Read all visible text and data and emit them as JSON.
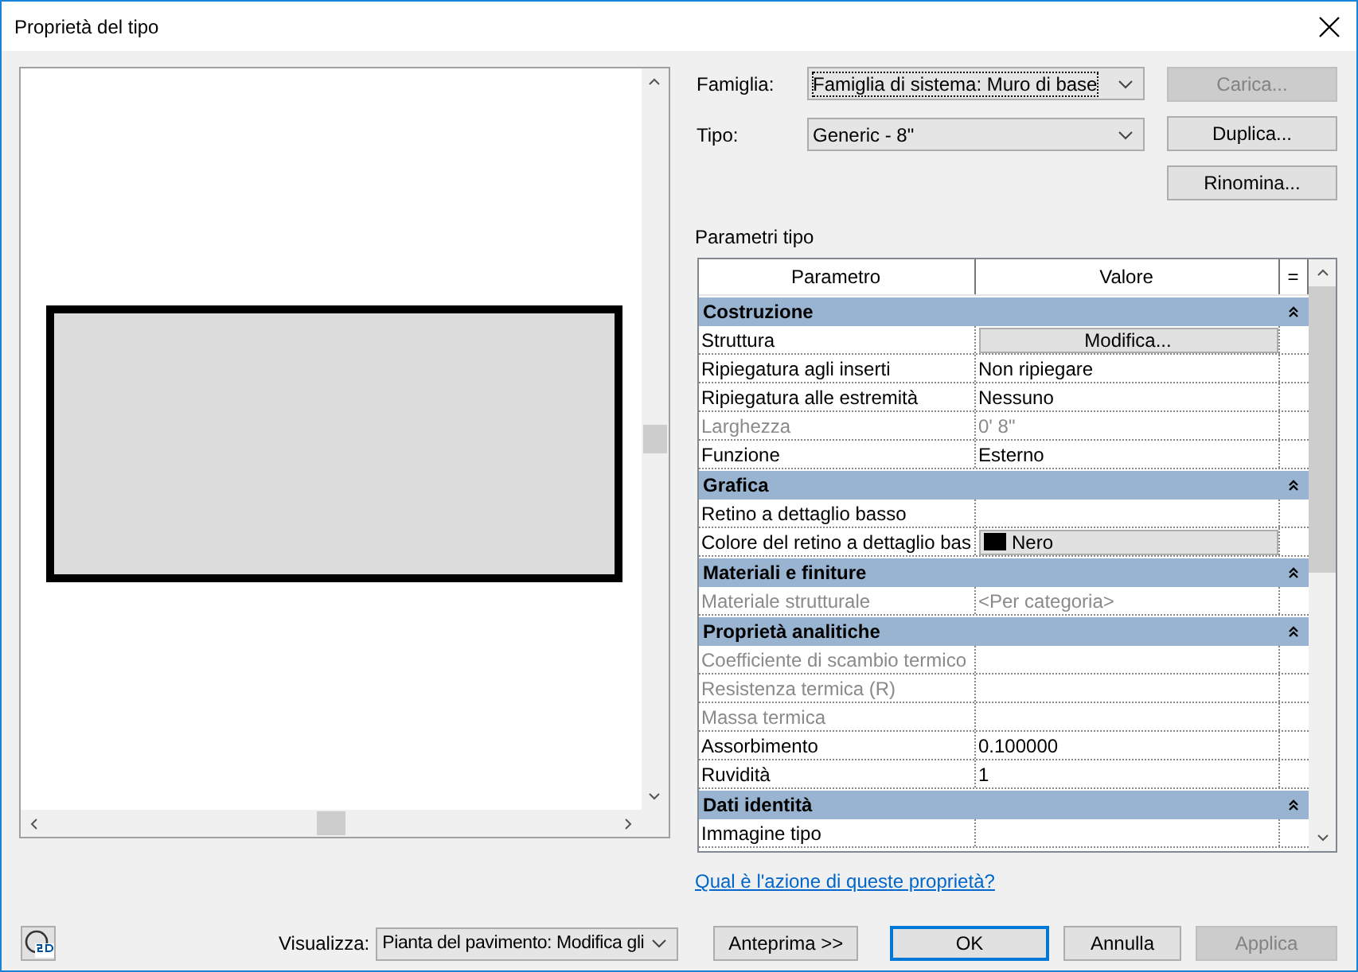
{
  "window": {
    "title": "Proprietà del tipo"
  },
  "family": {
    "label": "Famiglia:",
    "value": "Famiglia di sistema: Muro di base"
  },
  "type": {
    "label": "Tipo:",
    "value": "Generic - 8\""
  },
  "side_buttons": [
    {
      "label": "Carica...",
      "disabled": true
    },
    {
      "label": "Duplica...",
      "disabled": false
    },
    {
      "label": "Rinomina...",
      "disabled": false
    }
  ],
  "section_label": "Parametri tipo",
  "table": {
    "columns": [
      "Parametro",
      "Valore",
      "="
    ],
    "rows": [
      {
        "kind": "group",
        "label": "Costruzione",
        "expanded": true
      },
      {
        "kind": "button",
        "name": "Struttura",
        "value": "Modifica...",
        "disabled": false
      },
      {
        "kind": "text",
        "name": "Ripiegatura agli inserti",
        "value": "Non ripiegare",
        "disabled": false
      },
      {
        "kind": "text",
        "name": "Ripiegatura alle estremità",
        "value": "Nessuno",
        "disabled": false
      },
      {
        "kind": "text",
        "name": "Larghezza",
        "value": "0'  8\"",
        "disabled": true
      },
      {
        "kind": "text",
        "name": "Funzione",
        "value": "Esterno",
        "disabled": false
      },
      {
        "kind": "group",
        "label": "Grafica",
        "expanded": true
      },
      {
        "kind": "text",
        "name": "Retino a dettaglio basso",
        "disabled": false
      },
      {
        "kind": "color",
        "name": "Colore del retino a dettaglio bas",
        "value": "Nero",
        "color": "#000000",
        "disabled": false
      },
      {
        "kind": "group",
        "label": "Materiali e finiture",
        "expanded": true
      },
      {
        "kind": "text",
        "name": "Materiale strutturale",
        "value": "<Per categoria>",
        "disabled": true
      },
      {
        "kind": "group",
        "label": "Proprietà analitiche",
        "expanded": true
      },
      {
        "kind": "text",
        "name": "Coefficiente di scambio termico",
        "disabled": true
      },
      {
        "kind": "text",
        "name": "Resistenza termica (R)",
        "disabled": true
      },
      {
        "kind": "text",
        "name": "Massa termica",
        "disabled": true
      },
      {
        "kind": "text",
        "name": "Assorbimento",
        "value": "0.100000",
        "disabled": false
      },
      {
        "kind": "text",
        "name": "Ruvidità",
        "value": "1",
        "disabled": false
      },
      {
        "kind": "group",
        "label": "Dati identità",
        "expanded": true
      },
      {
        "kind": "text",
        "name": "Immagine tipo",
        "disabled": false
      }
    ]
  },
  "help_link": "Qual è l'azione di queste proprietà?",
  "view": {
    "label": "Visualizza:",
    "value": "Pianta del pavimento: Modifica gli"
  },
  "preview_button": "Anteprima >>",
  "buttons": [
    {
      "label": "OK",
      "default": true,
      "disabled": false
    },
    {
      "label": "Annulla",
      "default": false,
      "disabled": false
    },
    {
      "label": "Applica",
      "default": false,
      "disabled": true
    }
  ]
}
